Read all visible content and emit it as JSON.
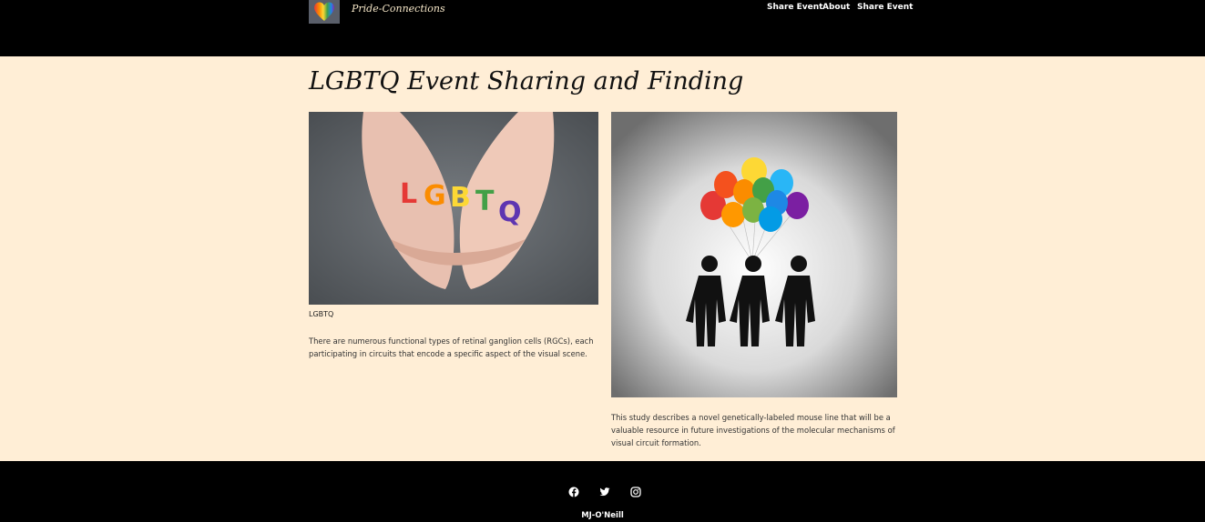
{
  "header": {
    "brand": "Pride-Connections",
    "logo": "rainbow-heart-logo",
    "nav": [
      "Share Event",
      "About",
      "Share Event"
    ]
  },
  "main": {
    "title": "LGBTQ Event Sharing and Finding",
    "cards": [
      {
        "image": "hands-holding-lgbtq-letters-photo",
        "caption": "LGBTQ",
        "text": "There are numerous functional types of retinal ganglion cells (RGCs), each participating in circuits that encode a specific aspect of the visual scene."
      },
      {
        "image": "three-figures-with-rainbow-balloons-photo",
        "text": "This study describes a novel genetically-labeled mouse line that will be a valuable resource in future investigations of the molecular mechanisms of visual circuit formation."
      }
    ]
  },
  "footer": {
    "social": [
      "facebook-icon",
      "twitter-icon",
      "instagram-icon"
    ],
    "author": "MJ-O'Neill"
  }
}
